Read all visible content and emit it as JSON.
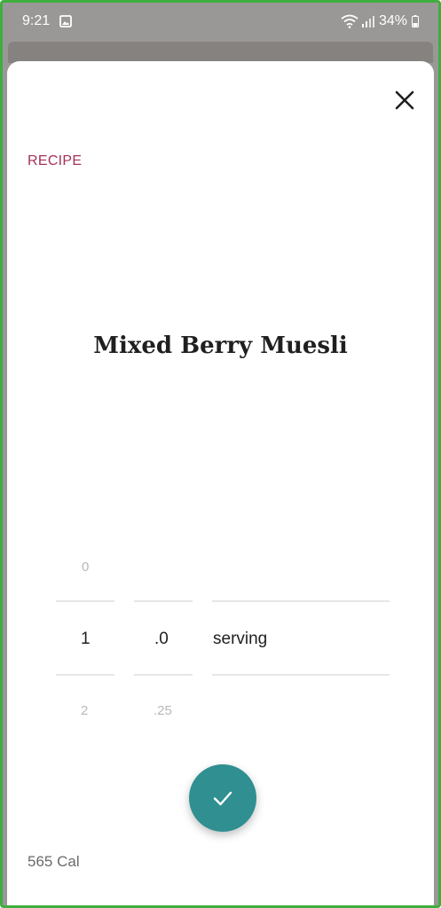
{
  "status_bar": {
    "time": "9:21",
    "battery": "34%",
    "icons": [
      "image-icon",
      "wifi-icon",
      "signal-icon",
      "battery-icon"
    ]
  },
  "sheet": {
    "close_icon": "close-icon",
    "category_label": "RECIPE",
    "title": "Mixed Berry Muesli",
    "picker": {
      "whole": {
        "above": "0",
        "selected": "1",
        "below": "2"
      },
      "fraction": {
        "above": "",
        "selected": ".0",
        "below": ".25"
      },
      "unit": {
        "selected": "serving"
      }
    },
    "confirm_icon": "checkmark-icon",
    "calories": "565 Cal"
  },
  "colors": {
    "accent": "#2f8f91",
    "category_label": "#a3305a",
    "frame_border": "#3fae3f",
    "status_bar_bg": "#9a9896"
  }
}
